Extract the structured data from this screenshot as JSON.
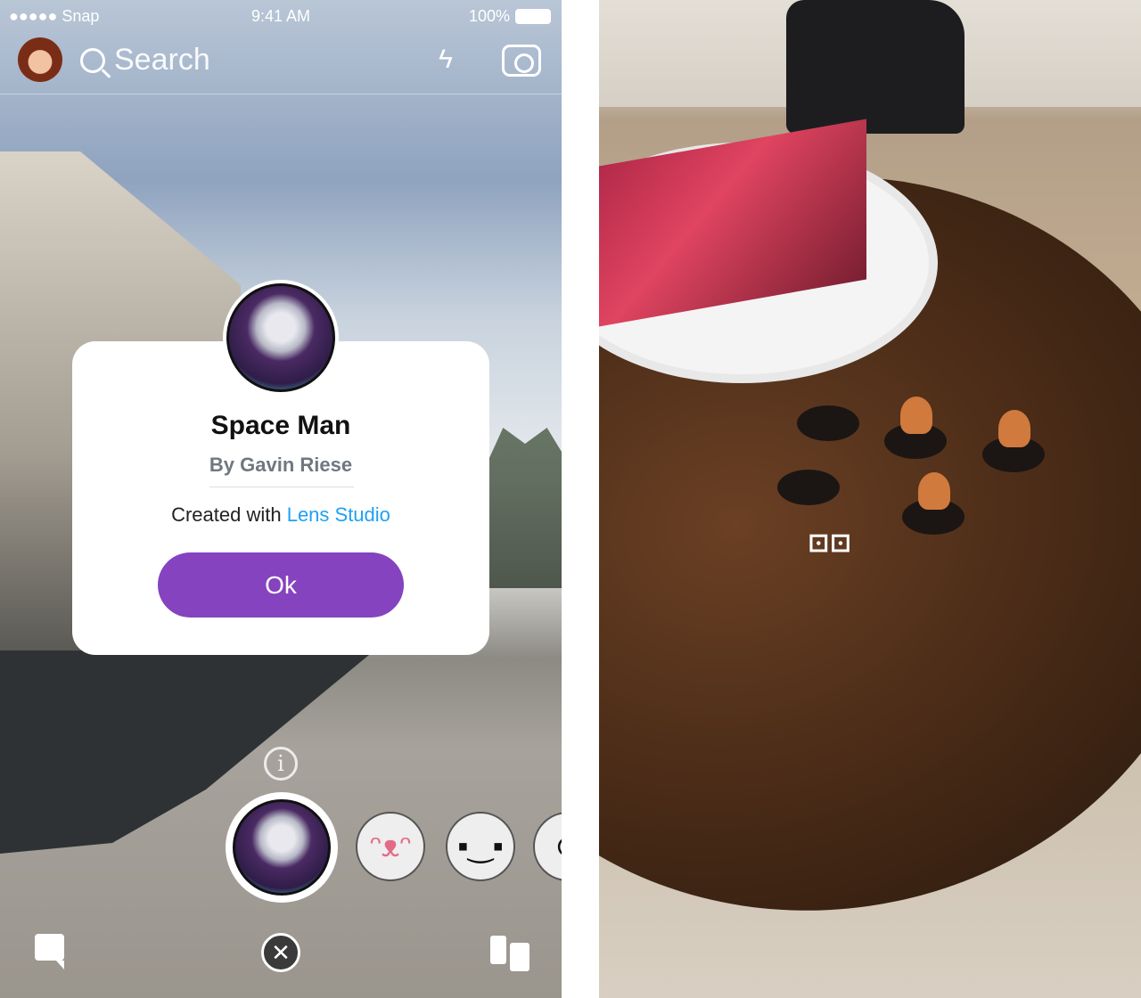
{
  "status_bar": {
    "carrier": "●●●●● Snap",
    "time": "9:41 AM",
    "battery": "100%"
  },
  "top_bar": {
    "search_placeholder": "Search",
    "icons": [
      "bitmoji-avatar",
      "search-icon",
      "flash-off-icon",
      "flip-camera-icon"
    ]
  },
  "lens_dialog": {
    "title": "Space Man",
    "author": "By Gavin Riese",
    "created_prefix": "Created with ",
    "created_link": "Lens Studio",
    "ok_label": "Ok",
    "link_color": "#1ea1f2",
    "button_color": "#8543bf"
  },
  "lens_carousel": {
    "info_label": "i",
    "items": [
      "space-man-lens",
      "tongue-face-lens",
      "pixel-smile-lens",
      "blush-face-lens"
    ]
  },
  "bottom_bar": {
    "close_label": "✕",
    "icons": [
      "chat-icon",
      "close-icon",
      "stories-icon"
    ]
  },
  "ar_photo": {
    "dice_label": "⚀⚀"
  }
}
